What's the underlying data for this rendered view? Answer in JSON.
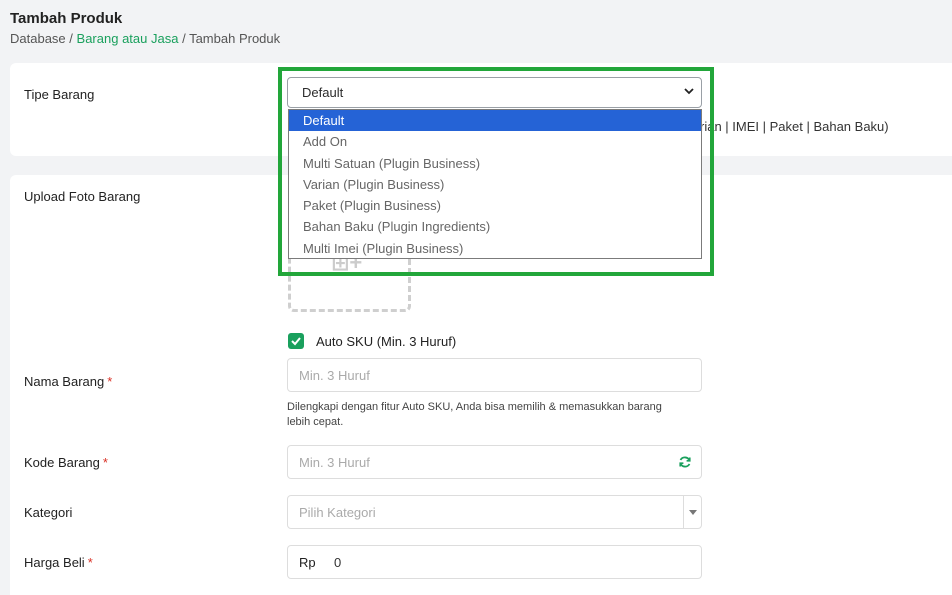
{
  "header": {
    "title": "Tambah Produk",
    "breadcrumb": {
      "root": "Database",
      "sep1": "/",
      "link": "Barang atau Jasa",
      "sep2": "/",
      "current": "Tambah Produk"
    }
  },
  "tipe_barang": {
    "label": "Tipe Barang",
    "selected": "Default",
    "hint_visible": "rian | IMEI | Paket | Bahan Baku)",
    "options": [
      "Default",
      "Add On",
      "Multi Satuan (Plugin Business)",
      "Varian (Plugin Business)",
      "Paket (Plugin Business)",
      "Bahan Baku (Plugin Ingredients)",
      "Multi Imei (Plugin Business)"
    ]
  },
  "upload": {
    "label": "Upload Foto Barang"
  },
  "auto_sku": {
    "label": "Auto SKU (Min. 3 Huruf)",
    "checked": true
  },
  "nama_barang": {
    "label": "Nama Barang",
    "required": "*",
    "placeholder": "Min. 3 Huruf",
    "help_line1": "Dilengkapi dengan fitur Auto SKU, Anda bisa memilih & memasukkan barang",
    "help_line2": "lebih cepat."
  },
  "kode_barang": {
    "label": "Kode Barang",
    "required": "*",
    "placeholder": "Min. 3 Huruf"
  },
  "kategori": {
    "label": "Kategori",
    "placeholder": "Pilih Kategori"
  },
  "harga_beli": {
    "label": "Harga Beli",
    "required": "*",
    "currency": "Rp",
    "value": "0"
  },
  "colors": {
    "accent": "#1aa05d",
    "selected_option": "#2563d6",
    "highlight_frame": "#22a63a",
    "required": "#d93025"
  },
  "icons": {
    "select_chevron": "chevron-down-icon",
    "checkbox": "check-icon",
    "refresh": "refresh-icon",
    "upload": "add-image-icon"
  }
}
